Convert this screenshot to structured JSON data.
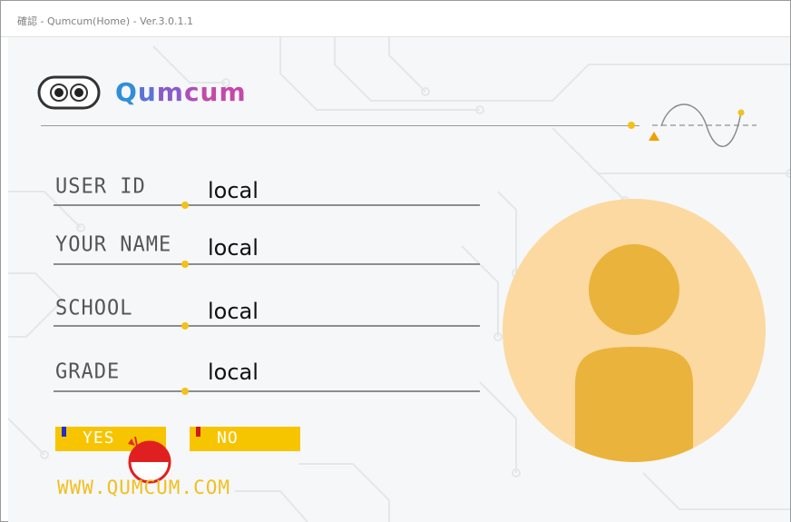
{
  "window": {
    "title": "確認 - Qumcum(Home) - Ver.3.0.1.1"
  },
  "brand": {
    "name_parts": [
      "Q",
      "u",
      "m",
      "c",
      "u",
      "m"
    ],
    "logo_icon": "robot-eyes-icon"
  },
  "form": {
    "fields": [
      {
        "label": "USER ID",
        "value": "local"
      },
      {
        "label": "YOUR NAME",
        "value": "local"
      },
      {
        "label": "SCHOOL",
        "value": "local"
      },
      {
        "label": "GRADE",
        "value": "local"
      }
    ]
  },
  "buttons": {
    "yes_label": "YES",
    "no_label": "NO"
  },
  "footer": {
    "website": "WWW.QUMCUM.COM"
  },
  "avatar": {
    "icon": "user-avatar-icon",
    "bg_color": "#fbd9a0",
    "figure_color": "#eab33c"
  },
  "colors": {
    "accent_yellow": "#f7c400",
    "dot_yellow": "#f3c218",
    "field_line": "#8d8d8d"
  }
}
